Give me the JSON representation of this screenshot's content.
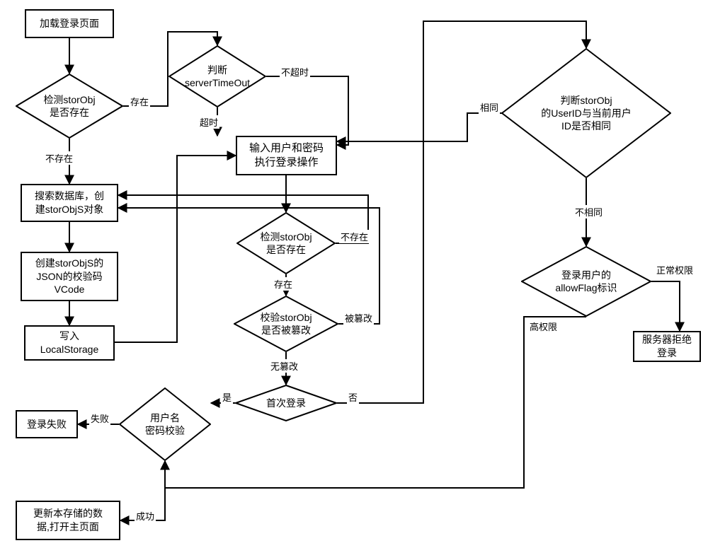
{
  "nodes": {
    "load_login_page": "加载登录页面",
    "check_storobj_exists_1": "检测storObj\n是否存在",
    "search_db_create_storobjs": "搜索数据库，创\n建storObjS对象",
    "create_storobjs_json_vcode": "创建storObjS的\nJSON的校验码\nVCode",
    "write_localstorage": "写入\nLocalStorage",
    "judge_server_timeout": "判断\nserverTimeOut",
    "input_user_pwd_login": "输入用户和密码\n执行登录操作",
    "check_storobj_exists_2": "检测storObj\n是否存在",
    "verify_storobj_tampered": "校验storObj\n是否被篡改",
    "first_login": "首次登录",
    "user_pwd_verify": "用户名\n密码校验",
    "login_failed": "登录失败",
    "update_local_open_main": "更新本存储的数\n据,打开主页面",
    "judge_userid_same": "判断storObj\n的UserID与当前用户\nID是否相同",
    "login_user_allowflag": "登录用户的\nallowFlag标识",
    "server_reject_login": "服务器拒绝登录"
  },
  "edge_labels": {
    "exists": "存在",
    "not_exists": "不存在",
    "not_timeout": "不超时",
    "timeout": "超时",
    "tampered": "被篡改",
    "not_tampered": "无篡改",
    "yes": "是",
    "no": "否",
    "fail": "失败",
    "success": "成功",
    "same": "相同",
    "not_same": "不相同",
    "normal_perm": "正常权限",
    "high_perm": "高权限"
  },
  "chart_data": {
    "type": "flowchart",
    "nodes": [
      {
        "id": "load_login_page",
        "kind": "process",
        "label": "加载登录页面"
      },
      {
        "id": "check_storobj_exists_1",
        "kind": "decision",
        "label": "检测storObj是否存在"
      },
      {
        "id": "search_db_create_storobjs",
        "kind": "process",
        "label": "搜索数据库，创建storObjS对象"
      },
      {
        "id": "create_storobjs_json_vcode",
        "kind": "process",
        "label": "创建storObjS的JSON的校验码VCode"
      },
      {
        "id": "write_localstorage",
        "kind": "process",
        "label": "写入LocalStorage"
      },
      {
        "id": "judge_server_timeout",
        "kind": "decision",
        "label": "判断serverTimeOut"
      },
      {
        "id": "input_user_pwd_login",
        "kind": "process",
        "label": "输入用户和密码执行登录操作"
      },
      {
        "id": "check_storobj_exists_2",
        "kind": "decision",
        "label": "检测storObj是否存在"
      },
      {
        "id": "verify_storobj_tampered",
        "kind": "decision",
        "label": "校验storObj是否被篡改"
      },
      {
        "id": "first_login",
        "kind": "decision",
        "label": "首次登录"
      },
      {
        "id": "user_pwd_verify",
        "kind": "decision",
        "label": "用户名密码校验"
      },
      {
        "id": "login_failed",
        "kind": "process",
        "label": "登录失败"
      },
      {
        "id": "update_local_open_main",
        "kind": "process",
        "label": "更新本存储的数据,打开主页面"
      },
      {
        "id": "judge_userid_same",
        "kind": "decision",
        "label": "判断storObj的UserID与当前用户ID是否相同"
      },
      {
        "id": "login_user_allowflag",
        "kind": "decision",
        "label": "登录用户的allowFlag标识"
      },
      {
        "id": "server_reject_login",
        "kind": "process",
        "label": "服务器拒绝登录"
      }
    ],
    "edges": [
      {
        "from": "load_login_page",
        "to": "check_storobj_exists_1"
      },
      {
        "from": "check_storobj_exists_1",
        "to": "search_db_create_storobjs",
        "label": "不存在"
      },
      {
        "from": "check_storobj_exists_1",
        "to": "judge_server_timeout",
        "label": "存在"
      },
      {
        "from": "judge_server_timeout",
        "to": "input_user_pwd_login",
        "label": "超时"
      },
      {
        "from": "judge_server_timeout",
        "to": "input_user_pwd_login",
        "label": "不超时",
        "note": "also routes via right side"
      },
      {
        "from": "search_db_create_storobjs",
        "to": "create_storobjs_json_vcode"
      },
      {
        "from": "create_storobjs_json_vcode",
        "to": "write_localstorage"
      },
      {
        "from": "write_localstorage",
        "to": "input_user_pwd_login"
      },
      {
        "from": "input_user_pwd_login",
        "to": "check_storobj_exists_2"
      },
      {
        "from": "check_storobj_exists_2",
        "to": "search_db_create_storobjs",
        "label": "不存在"
      },
      {
        "from": "check_storobj_exists_2",
        "to": "verify_storobj_tampered",
        "label": "存在"
      },
      {
        "from": "verify_storobj_tampered",
        "to": "search_db_create_storobjs",
        "label": "被篡改"
      },
      {
        "from": "verify_storobj_tampered",
        "to": "first_login",
        "label": "无篡改"
      },
      {
        "from": "first_login",
        "to": "user_pwd_verify",
        "label": "是"
      },
      {
        "from": "first_login",
        "to": "judge_userid_same",
        "label": "否"
      },
      {
        "from": "user_pwd_verify",
        "to": "login_failed",
        "label": "失败"
      },
      {
        "from": "user_pwd_verify",
        "to": "update_local_open_main",
        "label": "成功"
      },
      {
        "from": "judge_userid_same",
        "to": "input_user_pwd_login",
        "label": "相同"
      },
      {
        "from": "judge_userid_same",
        "to": "login_user_allowflag",
        "label": "不相同"
      },
      {
        "from": "login_user_allowflag",
        "to": "server_reject_login",
        "label": "正常权限"
      },
      {
        "from": "login_user_allowflag",
        "to": "user_pwd_verify",
        "label": "高权限"
      }
    ]
  }
}
